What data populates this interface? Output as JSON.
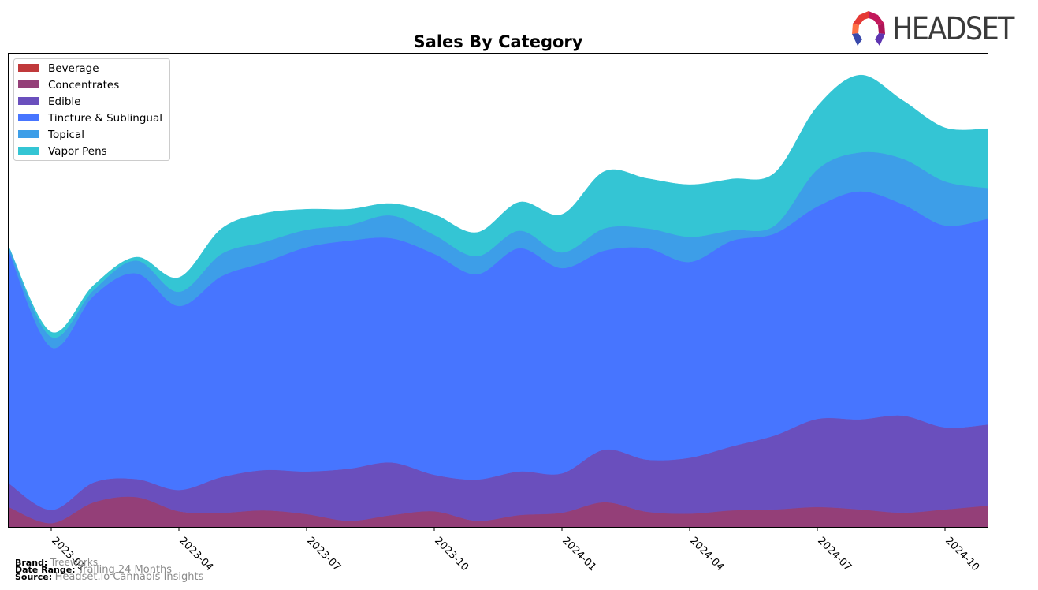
{
  "brand_logo": {
    "text": "HEADSET"
  },
  "footer": {
    "brand_label": "Brand:",
    "brand_value": "Treeworks",
    "date_range_label": "Date Range:",
    "date_range_value": "Trailing 24 Months",
    "source_label": "Source:",
    "source_value": "Headset.io Cannabis Insights"
  },
  "chart_data": {
    "type": "area",
    "stacked": true,
    "smoothed": true,
    "title": "Sales By Category",
    "xlabel": "",
    "ylabel": "",
    "y_axis_visible": false,
    "grid": false,
    "legend_position": "top-left",
    "x": [
      "2022-12",
      "2023-01",
      "2023-02",
      "2023-03",
      "2023-04",
      "2023-05",
      "2023-06",
      "2023-07",
      "2023-08",
      "2023-09",
      "2023-10",
      "2023-11",
      "2023-12",
      "2024-01",
      "2024-02",
      "2024-03",
      "2024-04",
      "2024-05",
      "2024-06",
      "2024-07",
      "2024-08",
      "2024-09",
      "2024-10",
      "2024-11"
    ],
    "x_tick_labels": [
      "2023-01",
      "2023-04",
      "2023-07",
      "2023-10",
      "2024-01",
      "2024-04",
      "2024-07",
      "2024-10"
    ],
    "ylim": [
      0,
      100
    ],
    "series": [
      {
        "name": "Beverage",
        "color": "#c0393b",
        "values": [
          0,
          0,
          0,
          0,
          0,
          0,
          0,
          0,
          0,
          0,
          0,
          0,
          0,
          0,
          0,
          0,
          0,
          0,
          0,
          0,
          0,
          0,
          0,
          0
        ]
      },
      {
        "name": "Concentrates",
        "color": "#943f78",
        "values": [
          4.2,
          0.8,
          5.2,
          6.3,
          3.3,
          3.0,
          3.5,
          2.7,
          1.3,
          2.5,
          3.3,
          1.3,
          2.5,
          3.0,
          5.2,
          3.2,
          2.8,
          3.5,
          3.7,
          4.2,
          3.7,
          3.0,
          3.7,
          4.5
        ]
      },
      {
        "name": "Edible",
        "color": "#6a4fbd",
        "values": [
          5.0,
          2.8,
          4.2,
          3.8,
          4.5,
          7.5,
          8.5,
          9.0,
          11.0,
          11.1,
          7.7,
          8.7,
          9.2,
          8.3,
          11.1,
          11.0,
          11.8,
          13.5,
          15.6,
          18.6,
          19.0,
          20.5,
          17.3,
          17.1
        ]
      },
      {
        "name": "Tincture & Sublingual",
        "color": "#4775ff",
        "values": [
          49.1,
          34.3,
          39.4,
          43.4,
          38.8,
          42.4,
          43.8,
          47.3,
          48.1,
          47.3,
          46.6,
          43.3,
          47.1,
          43.3,
          42.0,
          44.6,
          41.3,
          43.4,
          42.6,
          44.8,
          48.1,
          44.6,
          42.6,
          43.4
        ]
      },
      {
        "name": "Topical",
        "color": "#3d9ee8",
        "values": [
          0.8,
          2.2,
          1.2,
          2.7,
          3.0,
          4.7,
          4.3,
          3.7,
          3.3,
          4.8,
          4.0,
          3.8,
          3.7,
          3.3,
          4.7,
          4.2,
          5.3,
          2.2,
          1.7,
          7.8,
          8.2,
          9.6,
          9.3,
          6.5
        ]
      },
      {
        "name": "Vapor Pens",
        "color": "#34c5d4",
        "values": [
          0,
          1.0,
          1.0,
          0.7,
          3.0,
          5.3,
          6.0,
          4.3,
          3.3,
          2.5,
          4.3,
          5.0,
          6.0,
          8.0,
          12.0,
          10.5,
          11.0,
          10.8,
          11.1,
          13.3,
          16.3,
          12.3,
          11.3,
          12.5
        ]
      }
    ]
  }
}
